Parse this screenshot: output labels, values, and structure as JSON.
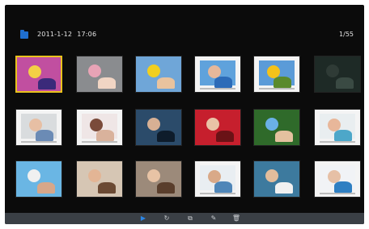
{
  "header": {
    "folder_icon": "folder-icon",
    "date": "2011-1-12",
    "time": "17:06",
    "counter": "1/55"
  },
  "thumbnails": [
    {
      "name": "photo-girl-umbrella",
      "bg": "#c14fa0",
      "a": "#f3d046",
      "b": "#3b2a7a",
      "selected": true,
      "framed": false
    },
    {
      "name": "photo-girls-pink",
      "bg": "#8a8c8f",
      "a": "#e8a3b6",
      "b": "#f1d5c4",
      "selected": false,
      "framed": false
    },
    {
      "name": "photo-boy-yellow",
      "bg": "#6fa6d8",
      "a": "#f1cf1f",
      "b": "#e9c39e",
      "selected": false,
      "framed": false
    },
    {
      "name": "photo-framed-kids-blue",
      "bg": "#5fa2dc",
      "a": "#e6b89a",
      "b": "#2c6bb8",
      "selected": false,
      "framed": true
    },
    {
      "name": "photo-framed-sunflower",
      "bg": "#5b9bd8",
      "a": "#f4c21a",
      "b": "#5a8a2c",
      "selected": false,
      "framed": true
    },
    {
      "name": "photo-dark-frame",
      "bg": "#1e2a26",
      "a": "#2f3b36",
      "b": "#3a4a43",
      "selected": false,
      "framed": false
    },
    {
      "name": "photo-framed-family",
      "bg": "#d9dcde",
      "a": "#e7bfa4",
      "b": "#6b8bb5",
      "selected": false,
      "framed": true
    },
    {
      "name": "photo-framed-friends",
      "bg": "#efe6e6",
      "a": "#7a4b3a",
      "b": "#d9b29c",
      "selected": false,
      "framed": true
    },
    {
      "name": "photo-group-blue-caption",
      "bg": "#2b4b6a",
      "a": "#d7b094",
      "b": "#0e1c2b",
      "selected": false,
      "framed": false
    },
    {
      "name": "photo-girl-red",
      "bg": "#c61f2d",
      "a": "#e9c3a6",
      "b": "#6a1216",
      "selected": false,
      "framed": false
    },
    {
      "name": "photo-kid-green",
      "bg": "#2f6a2a",
      "a": "#6ab0e6",
      "b": "#e4c19f",
      "selected": false,
      "framed": false
    },
    {
      "name": "photo-framed-girl-scarf",
      "bg": "#e9eef0",
      "a": "#e8b79a",
      "b": "#4da7c9",
      "selected": false,
      "framed": true
    },
    {
      "name": "photo-kid-hat",
      "bg": "#6ab6e4",
      "a": "#f0f0f0",
      "b": "#d7a78a",
      "selected": false,
      "framed": false
    },
    {
      "name": "photo-couple-beige",
      "bg": "#d6c6b4",
      "a": "#e3b595",
      "b": "#6b4a34",
      "selected": false,
      "framed": false
    },
    {
      "name": "photo-smiling-woman",
      "bg": "#9c8a7a",
      "a": "#e8c3a5",
      "b": "#5a3e2c",
      "selected": false,
      "framed": false
    },
    {
      "name": "photo-framed-boy-fish",
      "bg": "#e9eef2",
      "a": "#d9a988",
      "b": "#4f86b8",
      "selected": false,
      "framed": true
    },
    {
      "name": "photo-kids-playing",
      "bg": "#3d7a9e",
      "a": "#e3bd9c",
      "b": "#f1f1f1",
      "selected": false,
      "framed": false
    },
    {
      "name": "photo-framed-baby-blue",
      "bg": "#f1f3f6",
      "a": "#e6c0a6",
      "b": "#2f7fc2",
      "selected": false,
      "framed": true
    }
  ],
  "controls": [
    {
      "name": "play-icon",
      "glyph": "▶",
      "active": true
    },
    {
      "name": "rotate-icon",
      "glyph": "↻",
      "active": false
    },
    {
      "name": "copy-icon",
      "glyph": "⧉",
      "active": false
    },
    {
      "name": "settings-icon",
      "glyph": "✎",
      "active": false
    },
    {
      "name": "delete-icon",
      "glyph": "🗑",
      "active": false
    }
  ]
}
